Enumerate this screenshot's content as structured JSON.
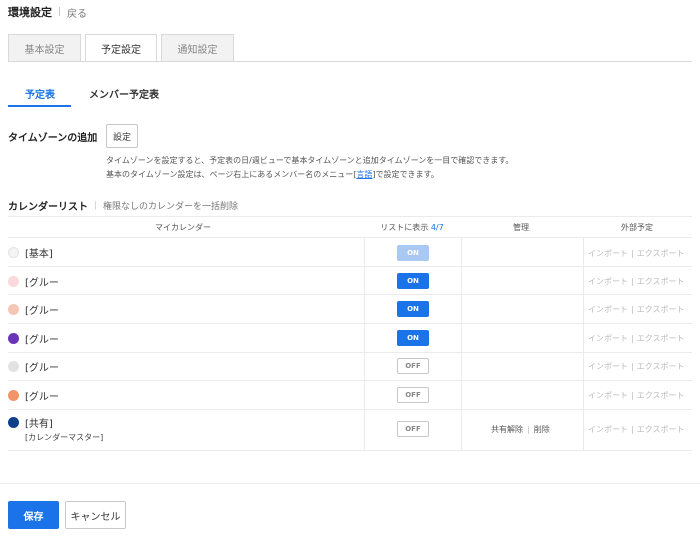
{
  "header": {
    "title": "環境設定",
    "back_label": "戻る"
  },
  "main_tabs": [
    {
      "label": "基本設定"
    },
    {
      "label": "予定設定"
    },
    {
      "label": "通知設定"
    }
  ],
  "sub_tabs": [
    {
      "label": "予定表"
    },
    {
      "label": "メンバー予定表"
    }
  ],
  "timezone": {
    "label": "タイムゾーンの追加",
    "button_label": "設定",
    "desc_line1": "タイムゾーンを設定すると、予定表の日/週ビューで基本タイムゾーンと追加タイムゾーンを一目で確認できます。",
    "desc_line2_pre": "基本のタイムゾーン設定は、ページ右上にあるメンバー名のメニュー[",
    "desc_line2_link": "言語",
    "desc_line2_post": "]で設定できます。"
  },
  "calendar_list": {
    "title": "カレンダーリスト",
    "bulk_delete_label": "権限なしのカレンダーを一括削除",
    "columns": {
      "my_calendar": "マイカレンダー",
      "show_in_list": "リストに表示",
      "show_count": "4/7",
      "manage": "管理",
      "external": "外部予定"
    },
    "rows": [
      {
        "name": "[基本]",
        "toggle": "ON"
      },
      {
        "name": "[グルー",
        "toggle": "ON"
      },
      {
        "name": "[グルー",
        "toggle": "ON"
      },
      {
        "name": "[グルー",
        "toggle": "ON"
      },
      {
        "name": "[グルー",
        "toggle": "OFF"
      },
      {
        "name": "[グルー",
        "toggle": "OFF"
      },
      {
        "name": "[共有]",
        "subtitle": "[カレンダーマスター]",
        "toggle": "OFF"
      }
    ],
    "manage_links": {
      "unshare": "共有解除",
      "delete": "削除"
    },
    "external_links": {
      "import": "インポート",
      "export": "エクスポート"
    }
  },
  "colors": {
    "accent": "#1a73e8",
    "swatches": [
      "#f4f4f4",
      "#f9d9dc",
      "#f5c6b3",
      "#6a34b8",
      "#e2e2e2",
      "#f0956a",
      "#0f3f8a"
    ]
  },
  "footer": {
    "save_label": "保存",
    "cancel_label": "キャンセル"
  }
}
